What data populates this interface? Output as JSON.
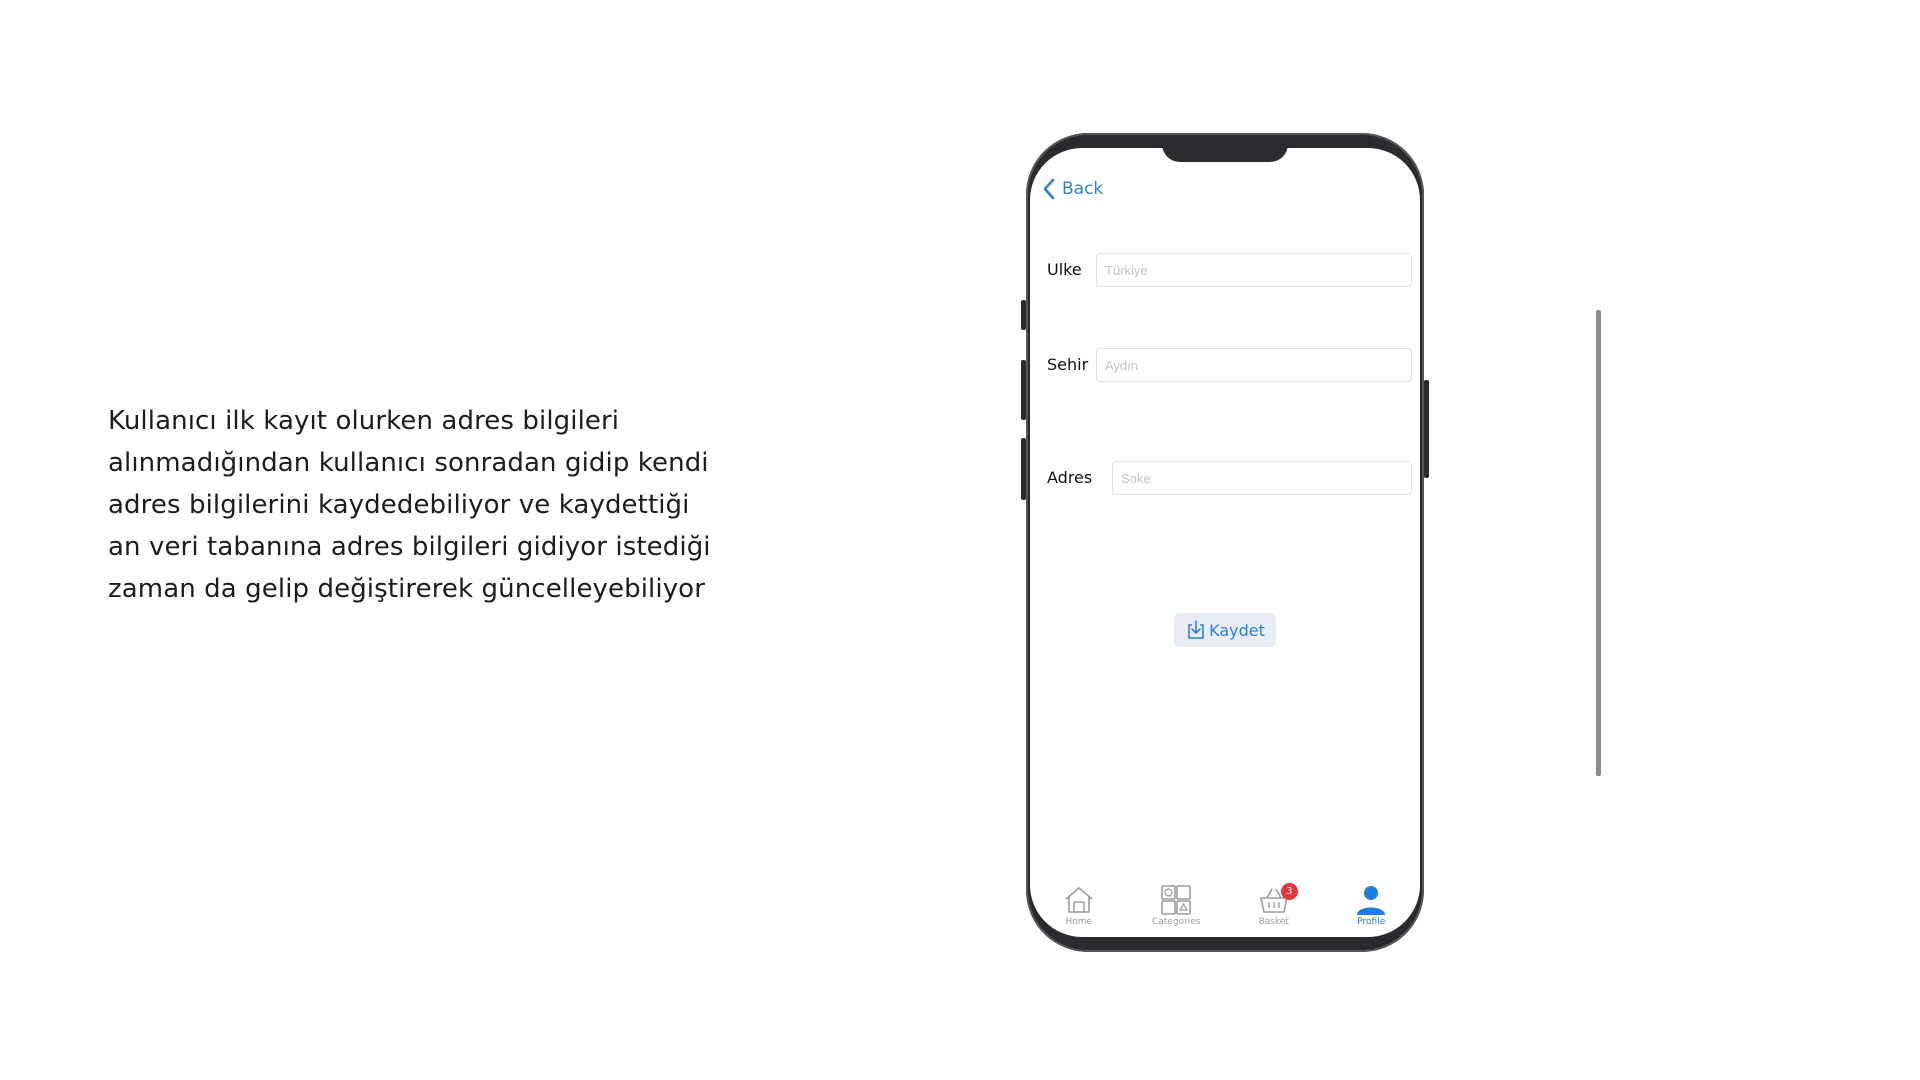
{
  "description": "Kullanıcı ilk kayıt olurken adres bilgileri\nalınmadığından kullanıcı sonradan gidip kendi\nadres bilgilerini kaydedebiliyor ve kaydettiği\nan veri tabanına adres bilgileri gidiyor istediği\nzaman da gelip değiştirerek güncelleyebiliyor",
  "nav": {
    "back_label": "Back"
  },
  "form": {
    "country_label": "Ulke",
    "country_placeholder": "Türkiye",
    "city_label": "Sehir",
    "city_placeholder": "Aydın",
    "address_label": "Adres",
    "address_placeholder": "Soke",
    "save_label": "Kaydet"
  },
  "tabbar": {
    "items": [
      {
        "label": "Home",
        "icon": "home-icon"
      },
      {
        "label": "Categories",
        "icon": "categories-icon"
      },
      {
        "label": "Basket",
        "icon": "basket-icon",
        "badge": "3"
      },
      {
        "label": "Profile",
        "icon": "profile-icon",
        "active": true
      }
    ]
  },
  "colors": {
    "accent": "#1e7de2",
    "badge": "#e8333a",
    "inactive": "#9c9c9c"
  }
}
